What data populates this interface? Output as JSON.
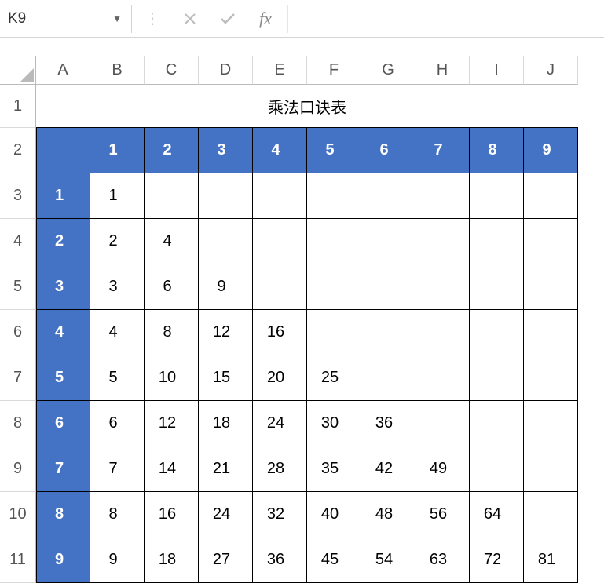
{
  "name_box": "K9",
  "fx_label": "fx",
  "formula_value": "",
  "col_headers": [
    "A",
    "B",
    "C",
    "D",
    "E",
    "F",
    "G",
    "H",
    "I",
    "J"
  ],
  "row_headers": [
    "1",
    "2",
    "3",
    "4",
    "5",
    "6",
    "7",
    "8",
    "9",
    "10",
    "11"
  ],
  "title": "乘法口诀表",
  "top_headers": [
    "",
    "1",
    "2",
    "3",
    "4",
    "5",
    "6",
    "7",
    "8",
    "9"
  ],
  "left_headers": [
    "1",
    "2",
    "3",
    "4",
    "5",
    "6",
    "7",
    "8",
    "9"
  ],
  "chart_data": {
    "type": "table",
    "title": "乘法口诀表",
    "columns": [
      1,
      2,
      3,
      4,
      5,
      6,
      7,
      8,
      9
    ],
    "rows": [
      1,
      2,
      3,
      4,
      5,
      6,
      7,
      8,
      9
    ],
    "values": [
      [
        1,
        "",
        "",
        "",
        "",
        "",
        "",
        "",
        ""
      ],
      [
        2,
        4,
        "",
        "",
        "",
        "",
        "",
        "",
        ""
      ],
      [
        3,
        6,
        9,
        "",
        "",
        "",
        "",
        "",
        ""
      ],
      [
        4,
        8,
        12,
        16,
        "",
        "",
        "",
        "",
        ""
      ],
      [
        5,
        10,
        15,
        20,
        25,
        "",
        "",
        "",
        ""
      ],
      [
        6,
        12,
        18,
        24,
        30,
        36,
        "",
        "",
        ""
      ],
      [
        7,
        14,
        21,
        28,
        35,
        42,
        49,
        "",
        ""
      ],
      [
        8,
        16,
        24,
        32,
        40,
        48,
        56,
        64,
        ""
      ],
      [
        9,
        18,
        27,
        36,
        45,
        54,
        63,
        72,
        81
      ]
    ]
  }
}
